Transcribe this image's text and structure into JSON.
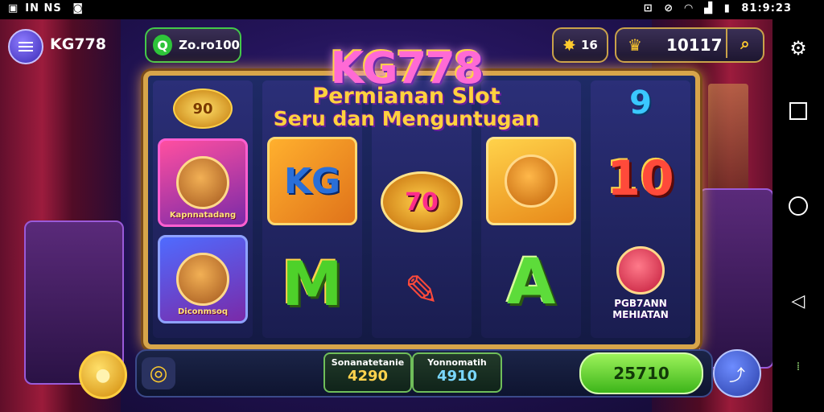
{
  "status_bar": {
    "left_text": "IN NS",
    "time": "81:9:23"
  },
  "header": {
    "brand": "KG778",
    "coins": "Zo.ro100",
    "gems": "16",
    "balance": "10117"
  },
  "title": {
    "logo": "KG778",
    "line1": "Permianan Slot",
    "line2": "Seru dan Menguntugan"
  },
  "reels": [
    {
      "symbols": [
        {
          "type": "coin",
          "text": "90"
        },
        {
          "type": "card",
          "text": "Kapnnatadang"
        },
        {
          "type": "card",
          "text": "Diconmsoq"
        }
      ]
    },
    {
      "symbols": [
        {
          "type": "tile",
          "text": "KG"
        },
        {
          "type": "tile",
          "text": "M"
        }
      ]
    },
    {
      "symbols": [
        {
          "type": "tile",
          "text": "70"
        },
        {
          "type": "tile",
          "text": ""
        }
      ]
    },
    {
      "symbols": [
        {
          "type": "tile",
          "text": ""
        },
        {
          "type": "tile",
          "text": "A"
        }
      ]
    },
    {
      "symbols": [
        {
          "type": "tile",
          "text": "9"
        },
        {
          "type": "tile",
          "text": "10"
        },
        {
          "type": "tile",
          "text": "PGB7ANN MEHIATAN"
        }
      ]
    }
  ],
  "bottom": {
    "stat1_label": "Sonanatetanie",
    "stat1_value": "4290",
    "stat2_label": "Yonnomatih",
    "stat2_value": "4910",
    "win_value": "25710"
  },
  "colors": {
    "accent_gold": "#d7a54a",
    "accent_green": "#3db51a",
    "title_pink": "#ff6ad5",
    "title_yellow": "#ffd23e"
  },
  "icons": [
    "menu-icon",
    "coin-icon",
    "gem-icon",
    "crown-icon",
    "search-icon",
    "gear-icon",
    "square-icon",
    "circle-icon",
    "back-icon",
    "spin-icon",
    "auto-icon"
  ]
}
